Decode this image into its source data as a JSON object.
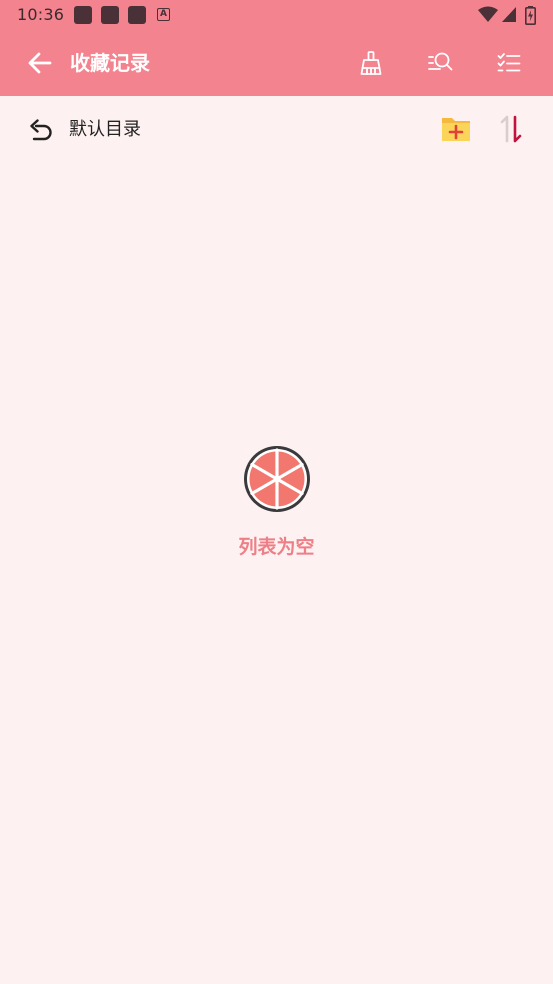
{
  "status_bar": {
    "time": "10:36",
    "notification_icons": [
      "app-icon",
      "app-icon",
      "app-icon",
      "a-icon"
    ],
    "system_icons": [
      "wifi-icon",
      "signal-icon",
      "battery-icon"
    ]
  },
  "toolbar": {
    "title": "收藏记录",
    "back_icon": "arrow-left-icon",
    "actions": [
      "broom-icon",
      "search-list-icon",
      "checklist-icon"
    ]
  },
  "directory": {
    "name": "默认目录",
    "back_icon": "undo-icon",
    "new_folder_icon": "folder-plus-icon",
    "sort_icon": "sort-icon"
  },
  "empty_state": {
    "icon": "grapefruit-icon",
    "message": "列表为空"
  },
  "colors": {
    "toolbar": "#F3838E",
    "background": "#FDF1F1",
    "accent": "#EE7F86",
    "folder": "#F9C74F",
    "sort_active": "#C0143C"
  }
}
